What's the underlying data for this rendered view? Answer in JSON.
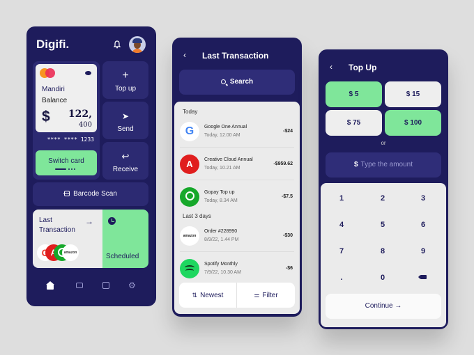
{
  "home": {
    "brand": "Digifi.",
    "card": {
      "bank": "Mandiri",
      "balance_label": "Balance",
      "currency": "$",
      "amount_main": "122,",
      "amount_sub": "400",
      "masked_number": "**** **** 1233"
    },
    "switch_card_label": "Switch card",
    "actions": [
      {
        "label": "Top up",
        "icon": "plus-icon",
        "glyph": "+"
      },
      {
        "label": "Send",
        "icon": "send-icon",
        "glyph": "➤"
      },
      {
        "label": "Receive",
        "icon": "reply-icon",
        "glyph": "↩"
      }
    ],
    "barcode_label": "Barcode Scan",
    "last_transaction_label": "Last Transaction",
    "last_transaction_arrow": "→",
    "mini_logos": [
      "G",
      "A",
      "",
      "amazon"
    ],
    "scheduled_label": "Scheduled",
    "nav": [
      "home-icon",
      "mail-icon",
      "chart-icon",
      "settings-icon"
    ],
    "gear_glyph": "⚙"
  },
  "transactions": {
    "back_glyph": "‹",
    "title": "Last Transaction",
    "search_label": "Search",
    "sections": [
      {
        "label": "Today",
        "items": [
          {
            "name": "Google One Annual",
            "time": "Today, 12.00 AM",
            "amount": "-$24",
            "logo": "google",
            "glyph": "G"
          },
          {
            "name": "Creative Cloud Annual",
            "time": "Today, 10.21 AM",
            "amount": "-$959.62",
            "logo": "adobe",
            "glyph": "A"
          },
          {
            "name": "Gopay Top up",
            "time": "Today, 8.34 AM",
            "amount": "-$7.5",
            "logo": "gopay",
            "glyph": ""
          }
        ]
      },
      {
        "label": "Last 3 days",
        "items": [
          {
            "name": "Order #228990",
            "time": "8/9/22, 1.44 PM",
            "amount": "-$30",
            "logo": "amazon",
            "glyph": "amazon"
          },
          {
            "name": "Spotify Monthly",
            "time": "7/9/22, 10.30 AM",
            "amount": "-$6",
            "logo": "spotify",
            "glyph": ""
          }
        ]
      }
    ],
    "sort_label": "Newest",
    "sort_glyph": "⇅",
    "filter_label": "Filter",
    "filter_glyph": "⚌"
  },
  "topup": {
    "back_glyph": "‹",
    "title": "Top Up",
    "amounts": [
      {
        "label": "$ 5",
        "selected": true
      },
      {
        "label": "$ 15",
        "selected": false
      },
      {
        "label": "$ 75",
        "selected": false
      },
      {
        "label": "$ 100",
        "selected": true
      }
    ],
    "or_label": "or",
    "input_currency": "$",
    "input_placeholder": "Type the amount",
    "keys": [
      "1",
      "2",
      "3",
      "4",
      "5",
      "6",
      "7",
      "8",
      "9",
      ".",
      "0",
      "⌫"
    ],
    "continue_label": "Continue →"
  },
  "colors": {
    "navy": "#1e1c5c",
    "tile": "#2c2a72",
    "accent_green": "#7fe69a",
    "light": "#ebebeb",
    "background": "#dedede"
  }
}
